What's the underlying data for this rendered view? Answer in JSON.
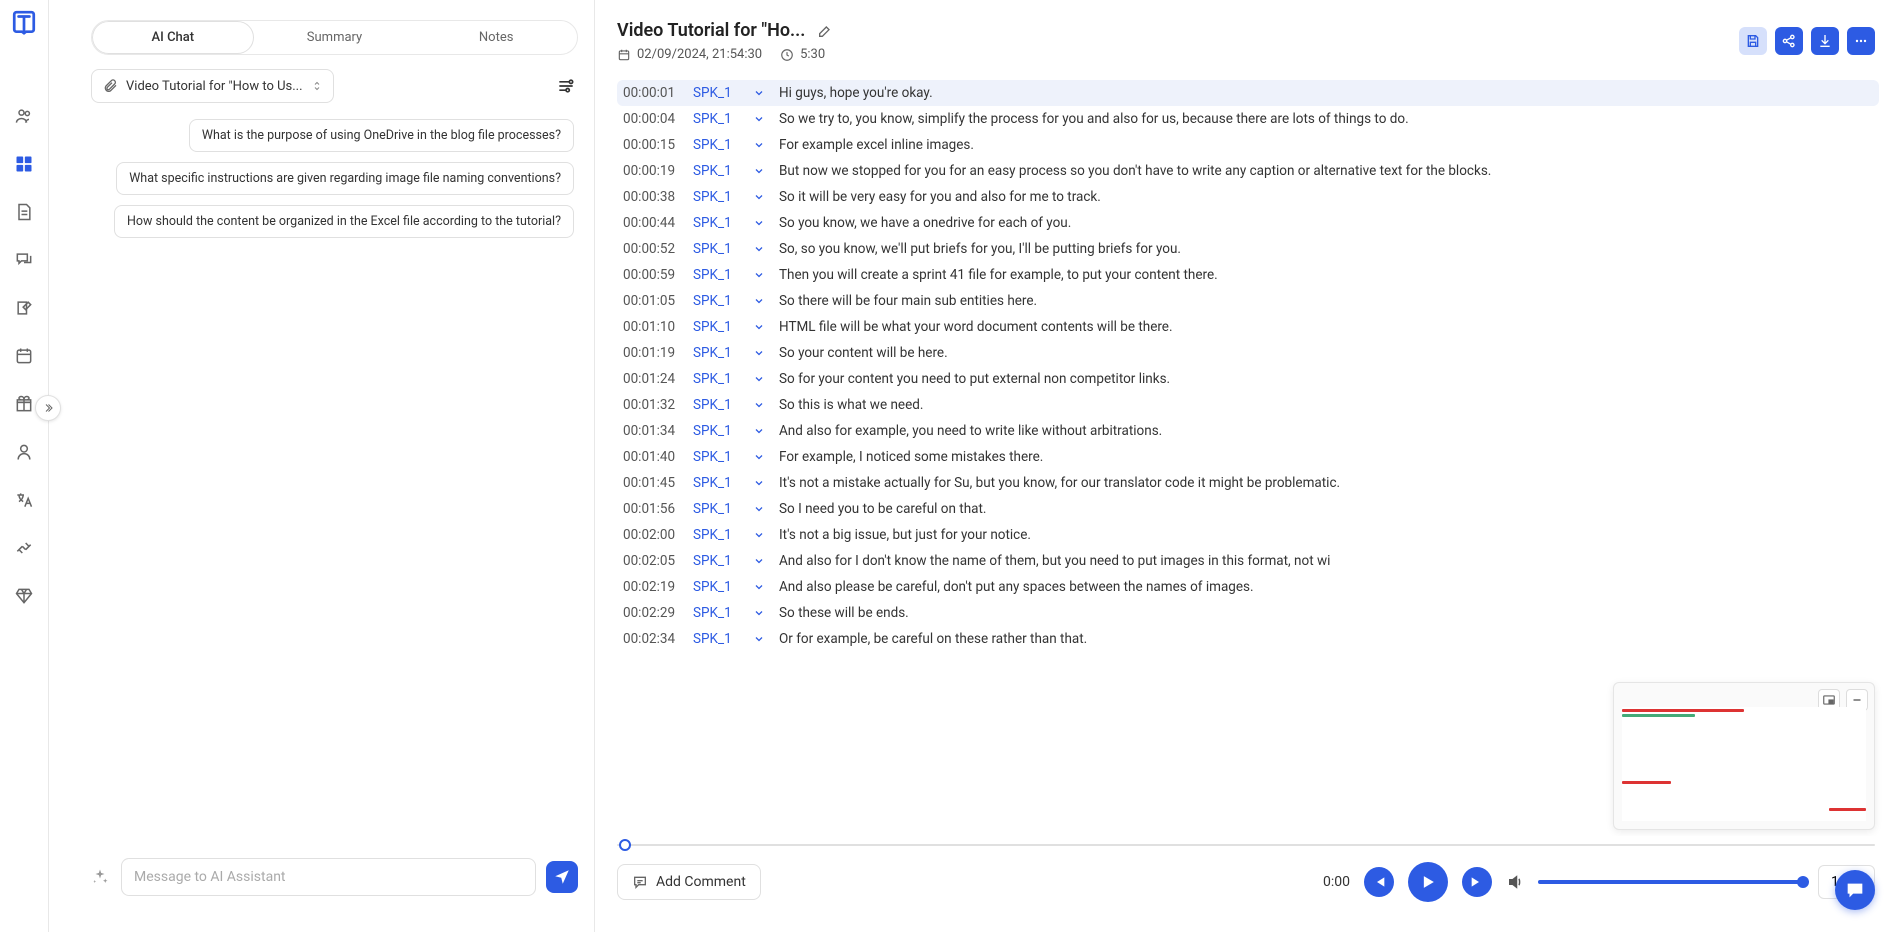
{
  "tabs": {
    "ai_chat": "AI Chat",
    "summary": "Summary",
    "notes": "Notes"
  },
  "source": {
    "label": "Video Tutorial for \"How to Us..."
  },
  "suggestions": [
    "What is the purpose of using OneDrive in the blog file processes?",
    "What specific instructions are given regarding image file naming conventions?",
    "How should the content be organized in the Excel file according to the tutorial?"
  ],
  "chat": {
    "placeholder": "Message to AI Assistant"
  },
  "header": {
    "title": "Video Tutorial for \"Ho...",
    "date": "02/09/2024, 21:54:30",
    "duration": "5:30"
  },
  "transcript": [
    {
      "ts": "00:00:01",
      "spk": "SPK_1",
      "txt": "Hi guys, hope you're okay.",
      "current": true
    },
    {
      "ts": "00:00:04",
      "spk": "SPK_1",
      "txt": "So we try to, you know, simplify the process for you and also for us, because there are lots of things to do."
    },
    {
      "ts": "00:00:15",
      "spk": "SPK_1",
      "txt": "For example excel inline images."
    },
    {
      "ts": "00:00:19",
      "spk": "SPK_1",
      "txt": "But now we stopped for you for an easy process so you don't have to write any caption or alternative text for the blocks."
    },
    {
      "ts": "00:00:38",
      "spk": "SPK_1",
      "txt": "So it will be very easy for you and also for me to track."
    },
    {
      "ts": "00:00:44",
      "spk": "SPK_1",
      "txt": "So you know, we have a onedrive for each of you."
    },
    {
      "ts": "00:00:52",
      "spk": "SPK_1",
      "txt": "So, so you know, we'll put briefs for you, I'll be putting briefs for you."
    },
    {
      "ts": "00:00:59",
      "spk": "SPK_1",
      "txt": "Then you will create a sprint 41 file for example, to put your content there."
    },
    {
      "ts": "00:01:05",
      "spk": "SPK_1",
      "txt": "So there will be four main sub entities here."
    },
    {
      "ts": "00:01:10",
      "spk": "SPK_1",
      "txt": "HTML file will be what your word document contents will be there."
    },
    {
      "ts": "00:01:19",
      "spk": "SPK_1",
      "txt": "So your content will be here."
    },
    {
      "ts": "00:01:24",
      "spk": "SPK_1",
      "txt": "So for your content you need to put external non competitor links."
    },
    {
      "ts": "00:01:32",
      "spk": "SPK_1",
      "txt": "So this is what we need."
    },
    {
      "ts": "00:01:34",
      "spk": "SPK_1",
      "txt": "And also for example, you need to write like without arbitrations."
    },
    {
      "ts": "00:01:40",
      "spk": "SPK_1",
      "txt": "For example, I noticed some mistakes there."
    },
    {
      "ts": "00:01:45",
      "spk": "SPK_1",
      "txt": "It's not a mistake actually for Su, but you know, for our translator code it might be problematic."
    },
    {
      "ts": "00:01:56",
      "spk": "SPK_1",
      "txt": "So I need you to be careful on that."
    },
    {
      "ts": "00:02:00",
      "spk": "SPK_1",
      "txt": "It's not a big issue, but just for your notice."
    },
    {
      "ts": "00:02:05",
      "spk": "SPK_1",
      "txt": "And also for I don't know the name of them, but you need to put images in this format, not wi"
    },
    {
      "ts": "00:02:19",
      "spk": "SPK_1",
      "txt": "And also please be careful, don't put any spaces between the names of images."
    },
    {
      "ts": "00:02:29",
      "spk": "SPK_1",
      "txt": "So these will be ends."
    },
    {
      "ts": "00:02:34",
      "spk": "SPK_1",
      "txt": "Or for example, be careful on these rather than that."
    }
  ],
  "player": {
    "add_comment": "Add Comment",
    "time": "0:00",
    "speed": "1x"
  }
}
